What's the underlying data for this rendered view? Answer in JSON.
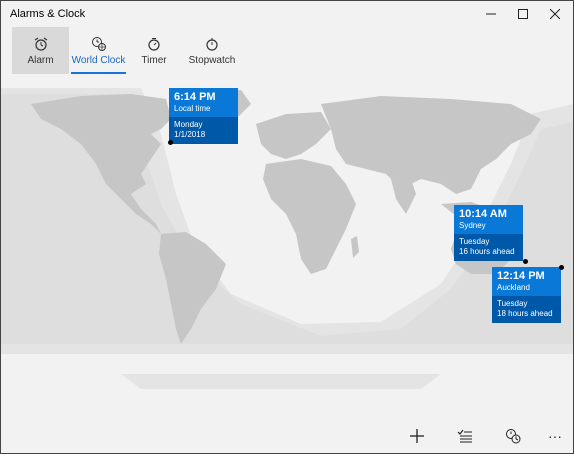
{
  "app": {
    "title": "Alarms & Clock"
  },
  "tabs": [
    {
      "label": "Alarm",
      "icon": "alarm-clock-icon",
      "selected": false
    },
    {
      "label": "World Clock",
      "icon": "world-clock-icon",
      "selected": true
    },
    {
      "label": "Timer",
      "icon": "timer-icon",
      "selected": false
    },
    {
      "label": "Stopwatch",
      "icon": "stopwatch-icon",
      "selected": false
    }
  ],
  "clocks": [
    {
      "time": "6:14 PM",
      "place": "Local time",
      "day": "Monday",
      "detail": "1/1/2018"
    },
    {
      "time": "10:14 AM",
      "place": "Sydney",
      "day": "Tuesday",
      "detail": "16 hours ahead"
    },
    {
      "time": "12:14 PM",
      "place": "Auckland",
      "day": "Tuesday",
      "detail": "18 hours ahead"
    }
  ],
  "toolbar": [
    {
      "icon": "add-icon"
    },
    {
      "icon": "edit-list-icon"
    },
    {
      "icon": "compare-clock-icon"
    },
    {
      "icon": "more-icon",
      "glyph": "···"
    }
  ],
  "colors": {
    "accent": "#0a78d7",
    "accent_dark": "#0058a8",
    "land": "#c9c9c9",
    "night": "#e0e0e0"
  }
}
